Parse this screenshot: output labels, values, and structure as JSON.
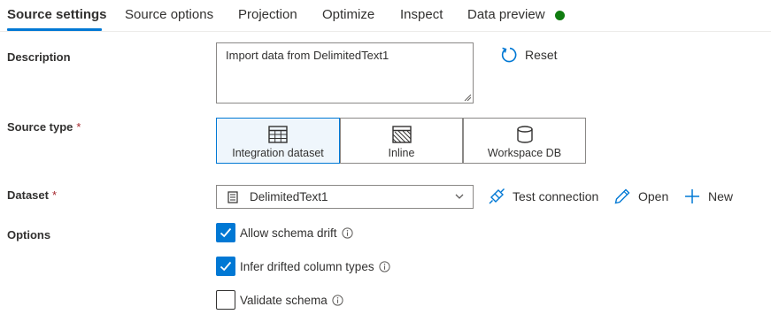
{
  "tabs": [
    {
      "label": "Source settings",
      "active": true
    },
    {
      "label": "Source options"
    },
    {
      "label": "Projection"
    },
    {
      "label": "Optimize"
    },
    {
      "label": "Inspect"
    },
    {
      "label": "Data preview",
      "status_color": "#107c10"
    }
  ],
  "description": {
    "label": "Description",
    "value": "Import data from DelimitedText1",
    "reset_label": "Reset"
  },
  "source_type": {
    "label": "Source type",
    "required_mark": "*",
    "options": [
      {
        "label": "Integration dataset",
        "icon": "table-icon",
        "selected": true
      },
      {
        "label": "Inline",
        "icon": "hatched-box-icon"
      },
      {
        "label": "Workspace DB",
        "icon": "database-icon"
      }
    ]
  },
  "dataset": {
    "label": "Dataset",
    "required_mark": "*",
    "value": "DelimitedText1",
    "actions": {
      "test_connection": "Test connection",
      "open": "Open",
      "new": "New"
    }
  },
  "options": {
    "label": "Options",
    "items": [
      {
        "label": "Allow schema drift",
        "checked": true
      },
      {
        "label": "Infer drifted column types",
        "checked": true
      },
      {
        "label": "Validate schema",
        "checked": false
      }
    ]
  },
  "colors": {
    "accent": "#0078d4",
    "success": "#107c10",
    "required": "#a4262c"
  }
}
